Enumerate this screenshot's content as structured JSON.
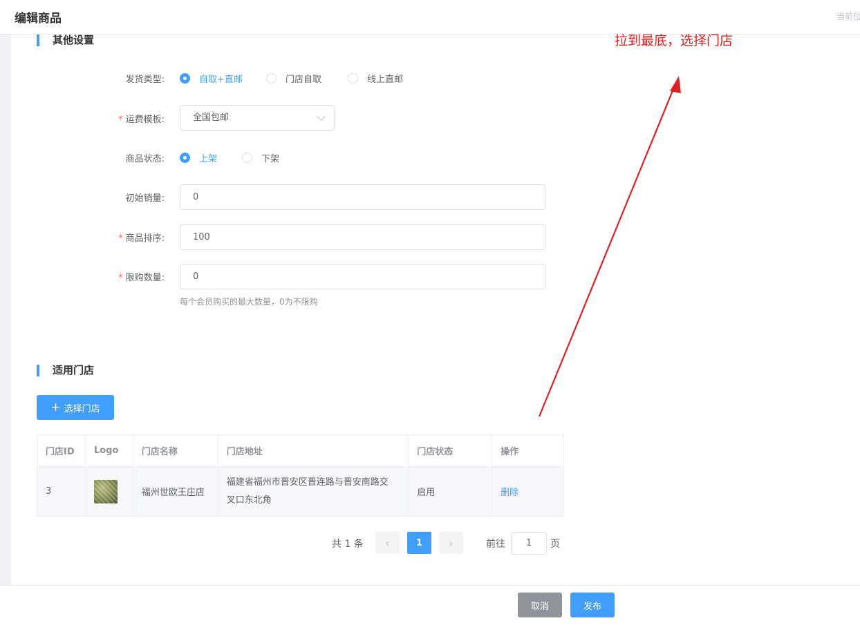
{
  "header": {
    "title": "编辑商品",
    "breadcrumb": "当前位置"
  },
  "other_settings": {
    "title": "其他设置",
    "shipping_type": {
      "label": "发货类型:",
      "options": [
        "自取+直邮",
        "门店自取",
        "线上直邮"
      ],
      "selected": "自取+直邮"
    },
    "freight_template": {
      "label": "运费模板:",
      "required": true,
      "value": "全国包邮"
    },
    "status": {
      "label": "商品状态:",
      "options": [
        "上架",
        "下架"
      ],
      "selected": "上架"
    },
    "initial_sales": {
      "label": "初始销量:",
      "value": "0"
    },
    "sort": {
      "label": "商品排序:",
      "required": true,
      "value": "100"
    },
    "limit": {
      "label": "限购数量:",
      "required": true,
      "value": "0",
      "hint": "每个会员购买的最大数量，0为不限购"
    }
  },
  "stores": {
    "title": "适用门店",
    "select_button": "选择门店",
    "columns": [
      "门店ID",
      "Logo",
      "门店名称",
      "门店地址",
      "门店状态",
      "操作"
    ],
    "rows": [
      {
        "id": "3",
        "name": "福州世欧王庄店",
        "address_line1": "福建省福州市晋安区晋连路与晋安南路交",
        "address_line2": "叉口东北角",
        "status": "启用",
        "action": "删除"
      }
    ]
  },
  "pagination": {
    "total": "共 1 条",
    "current": "1",
    "goto_label": "前往",
    "goto_value": "1",
    "page_unit": "页"
  },
  "footer": {
    "cancel": "取消",
    "publish": "发布"
  },
  "annotation": {
    "text": "拉到最底，选择门店",
    "color": "#e02020"
  },
  "colors": {
    "primary": "#409eff",
    "success": "#67c23a",
    "danger": "#f56c6c"
  }
}
